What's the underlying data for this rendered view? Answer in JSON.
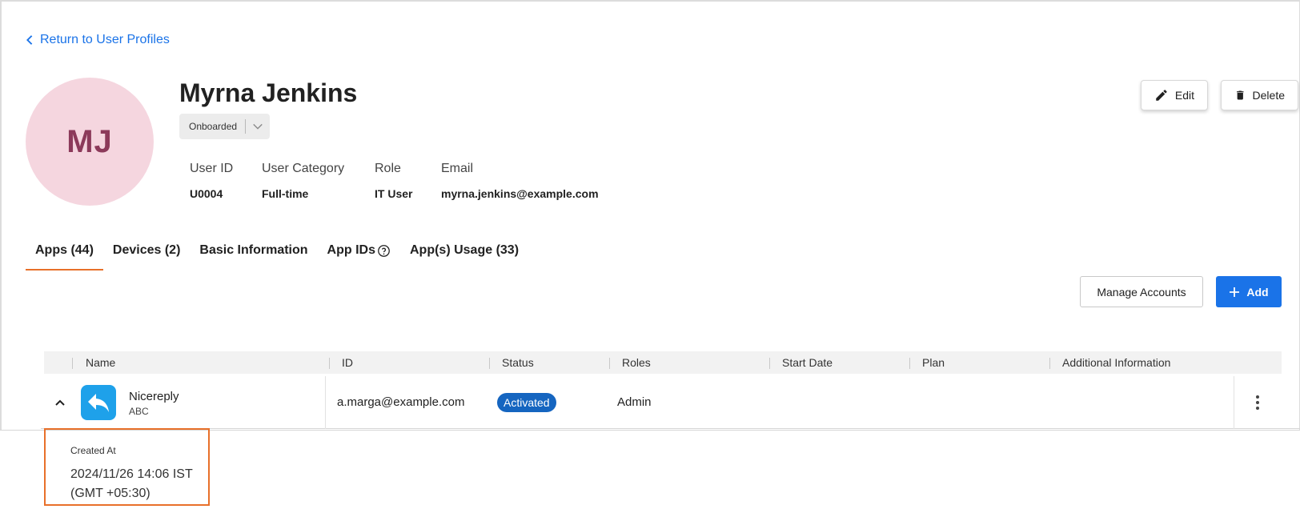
{
  "nav": {
    "back_label": "Return to User Profiles"
  },
  "profile": {
    "initials": "MJ",
    "name": "Myrna Jenkins",
    "status": "Onboarded",
    "fields": [
      {
        "label": "User ID",
        "value": "U0004"
      },
      {
        "label": "User Category",
        "value": "Full-time"
      },
      {
        "label": "Role",
        "value": "IT User"
      },
      {
        "label": "Email",
        "value": "myrna.jenkins@example.com"
      }
    ],
    "edit_label": "Edit",
    "delete_label": "Delete"
  },
  "tabs": [
    {
      "label": "Apps (44)",
      "active": true
    },
    {
      "label": "Devices (2)",
      "active": false
    },
    {
      "label": "Basic Information",
      "active": false
    },
    {
      "label": "App IDs",
      "active": false,
      "icon": "help-circle-icon"
    },
    {
      "label": "App(s) Usage (33)",
      "active": false
    }
  ],
  "actions": {
    "manage_label": "Manage Accounts",
    "add_label": "Add"
  },
  "table": {
    "columns": [
      "Name",
      "ID",
      "Status",
      "Roles",
      "Start Date",
      "Plan",
      "Additional Information"
    ],
    "rows": [
      {
        "name": "Nicereply",
        "subtitle": "ABC",
        "id": "a.marga@example.com",
        "status": "Activated",
        "roles": "Admin",
        "start_date": "",
        "plan": "",
        "additional": ""
      }
    ],
    "expanded": {
      "label": "Created At",
      "value": "2024/11/26 14:06 IST (GMT +05:30)"
    }
  },
  "colors": {
    "accent": "#1a73e8",
    "tab_underline": "#e8702a",
    "status_badge": "#1565c0",
    "avatar_bg": "#f5d6df",
    "avatar_text": "#8c3a5a",
    "app_icon_bg": "#1ea1ea"
  }
}
